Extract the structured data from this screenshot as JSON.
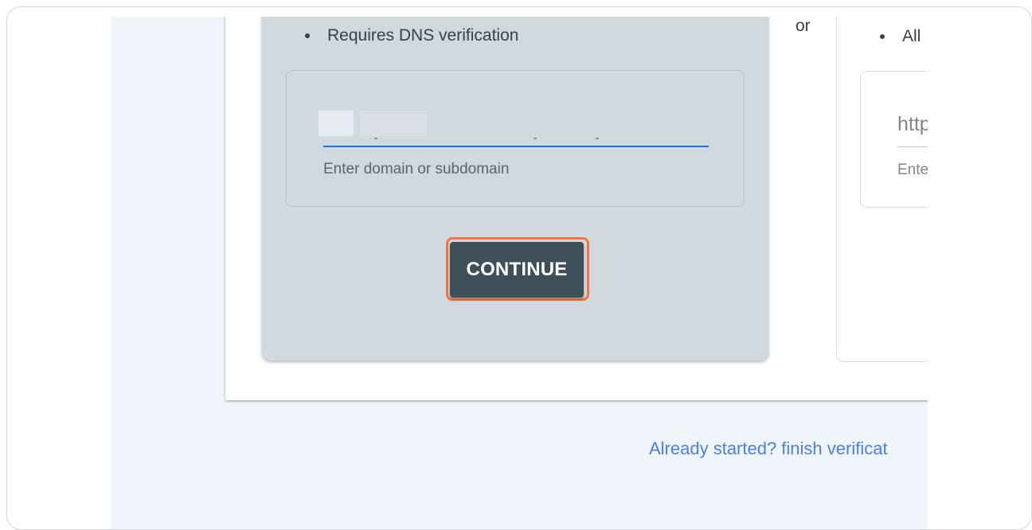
{
  "domain_option": {
    "bullet": "Requires DNS verification",
    "input_value": "",
    "input_helper": "Enter domain or subdomain",
    "continue_label": "CONTINUE"
  },
  "separator": {
    "label": "or"
  },
  "url_prefix_option": {
    "bullet": "All",
    "input_placeholder": "http",
    "input_helper": "Ente"
  },
  "footer": {
    "finish_link": "Already started? finish verificat"
  },
  "colors": {
    "page_background": "#f0f4fb",
    "domain_panel": "#d1d8de",
    "continue_button": "#3f4f59",
    "highlight_outline": "#f4743b",
    "input_focus_line": "#1a73e8",
    "link": "#4a7fe6"
  }
}
